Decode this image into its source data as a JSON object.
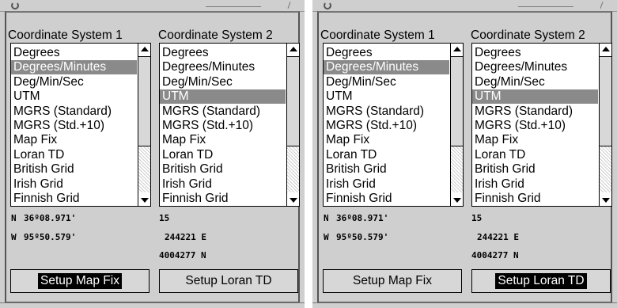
{
  "screens": [
    {
      "system1": {
        "title": "Coordinate System 1",
        "items": [
          "Degrees",
          "Degrees/Minutes",
          "Deg/Min/Sec",
          "UTM",
          "MGRS (Standard)",
          "MGRS (Std.+10)",
          "Map Fix",
          "Loran TD",
          "British Grid",
          "Irish Grid",
          "Finnish Grid"
        ],
        "selected": "Degrees/Minutes"
      },
      "system2": {
        "title": "Coordinate System 2",
        "items": [
          "Degrees",
          "Degrees/Minutes",
          "Deg/Min/Sec",
          "UTM",
          "MGRS (Standard)",
          "MGRS (Std.+10)",
          "Map Fix",
          "Loran TD",
          "British Grid",
          "Irish Grid",
          "Finnish Grid"
        ],
        "selected": "UTM"
      },
      "readout1": {
        "lat_label": "N",
        "lat_value": "36º08.971'",
        "lon_label": "W",
        "lon_value": "95º50.579'"
      },
      "readout2": {
        "zone": "15",
        "easting": "244221 E",
        "northing": "4004277 N"
      },
      "buttons": {
        "setup_map_fix": "Setup Map Fix",
        "setup_loran_td": "Setup Loran TD"
      },
      "active_button": "setup_map_fix"
    },
    {
      "system1": {
        "title": "Coordinate System 1",
        "items": [
          "Degrees",
          "Degrees/Minutes",
          "Deg/Min/Sec",
          "UTM",
          "MGRS (Standard)",
          "MGRS (Std.+10)",
          "Map Fix",
          "Loran TD",
          "British Grid",
          "Irish Grid",
          "Finnish Grid"
        ],
        "selected": "Degrees/Minutes"
      },
      "system2": {
        "title": "Coordinate System 2",
        "items": [
          "Degrees",
          "Degrees/Minutes",
          "Deg/Min/Sec",
          "UTM",
          "MGRS (Standard)",
          "MGRS (Std.+10)",
          "Map Fix",
          "Loran TD",
          "British Grid",
          "Irish Grid",
          "Finnish Grid"
        ],
        "selected": "UTM"
      },
      "readout1": {
        "lat_label": "N",
        "lat_value": "36º08.971'",
        "lon_label": "W",
        "lon_value": "95º50.579'"
      },
      "readout2": {
        "zone": "15",
        "easting": "244221 E",
        "northing": "4004277 N"
      },
      "buttons": {
        "setup_map_fix": "Setup Map Fix",
        "setup_loran_td": "Setup Loran TD"
      },
      "active_button": "setup_loran_td"
    }
  ],
  "colors": {
    "panel": "#cfcfcf",
    "selection": "#8a8a8a",
    "active_button": "#000000"
  }
}
